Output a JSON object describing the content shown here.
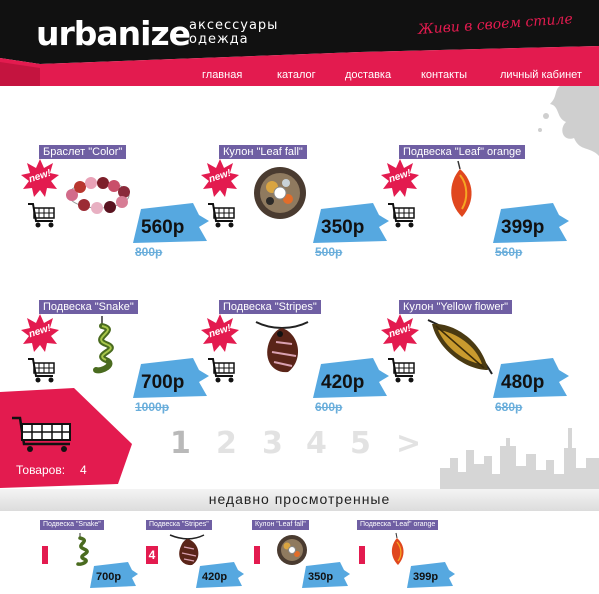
{
  "brand": {
    "logo": "urbanize",
    "subtitle_line1": "аксессуары",
    "subtitle_line2": "одежда",
    "slogan": "Живи в своем стиле"
  },
  "nav": [
    {
      "label": "главная"
    },
    {
      "label": "каталог"
    },
    {
      "label": "доставка"
    },
    {
      "label": "контакты"
    },
    {
      "label": "личный кабинет"
    }
  ],
  "products": [
    {
      "title": "Браслет \"Color\"",
      "badge": "new!",
      "price": "560р",
      "old_price": "800р",
      "icon": "bracelet-image"
    },
    {
      "title": "Кулон \"Leaf fall\"",
      "badge": "new!",
      "price": "350р",
      "old_price": "500р",
      "icon": "round-pendant-image"
    },
    {
      "title": "Подвеска \"Leaf\" orange",
      "badge": "new!",
      "price": "399р",
      "old_price": "560р",
      "icon": "orange-leaf-pendant-image"
    },
    {
      "title": "Подвеска \"Snake\"",
      "badge": "new!",
      "price": "700р",
      "old_price": "1000р",
      "icon": "snake-pendant-image"
    },
    {
      "title": "Подвеска \"Stripes\"",
      "badge": "new!",
      "price": "420р",
      "old_price": "600р",
      "icon": "stripes-pendant-image"
    },
    {
      "title": "Кулон \"Yellow flower\"",
      "badge": "new!",
      "price": "480р",
      "old_price": "680р",
      "icon": "leaf-pendant-image"
    }
  ],
  "cart": {
    "label": "Товаров:",
    "count": "4"
  },
  "pagination": {
    "pages": [
      "1",
      "2",
      "3",
      "4",
      "5"
    ],
    "next": ">",
    "current": "1"
  },
  "recent": {
    "title": "недавно просмотренные",
    "items": [
      {
        "title": "Подвеска \"Snake\"",
        "count": "",
        "price": "700р"
      },
      {
        "title": "Подвеска \"Stripes\"",
        "count": "4",
        "price": "420р"
      },
      {
        "title": "Кулон \"Leaf fall\"",
        "count": "",
        "price": "350р"
      },
      {
        "title": "Подвеска \"Leaf\" orange",
        "count": "",
        "price": "399р"
      }
    ]
  },
  "colors": {
    "brand_pink": "#e31b4f",
    "header_black": "#111111",
    "title_purple": "#6f5fa3",
    "price_blue": "#56a8e0",
    "old_price_blue": "#6aaedb"
  }
}
